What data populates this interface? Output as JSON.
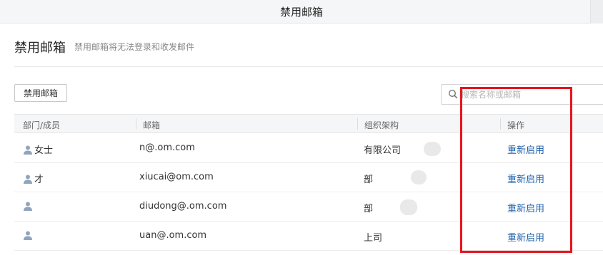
{
  "window": {
    "title": "禁用邮箱"
  },
  "page": {
    "title": "禁用邮箱",
    "description": "禁用邮箱将无法登录和收发邮件"
  },
  "toolbar": {
    "disable_button_label": "禁用邮箱"
  },
  "search": {
    "placeholder": "搜索名称或邮箱",
    "value": "",
    "icon": "search-icon"
  },
  "table": {
    "columns": [
      "部门/成员",
      "邮箱",
      "组织架构",
      "操作"
    ],
    "rows": [
      {
        "member": "女士",
        "email": "n@.om.com",
        "org": "有限公司",
        "action": "重新启用"
      },
      {
        "member": "才",
        "email": "xiucai@om.com",
        "org": "部",
        "action": "重新启用"
      },
      {
        "member": "",
        "email": "diudong@.om.com",
        "org": "部",
        "action": "重新启用"
      },
      {
        "member": "",
        "email": "uan@.om.com",
        "org": "上司",
        "action": "重新启用"
      }
    ]
  },
  "colors": {
    "link": "#1d5fa8",
    "highlight": "#e8141b",
    "header_bg": "#f5f6f7"
  }
}
